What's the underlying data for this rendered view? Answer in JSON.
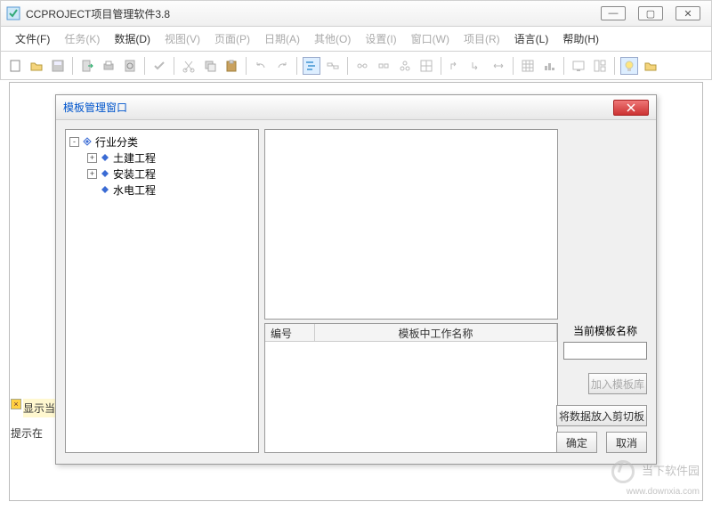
{
  "window": {
    "title": "CCPROJECT项目管理软件3.8"
  },
  "menu": {
    "file": "文件(F)",
    "task": "任务(K)",
    "data": "数据(D)",
    "view": "视图(V)",
    "page": "页面(P)",
    "date": "日期(A)",
    "other": "其他(O)",
    "settings": "设置(I)",
    "window": "窗口(W)",
    "project": "项目(R)",
    "language": "语言(L)",
    "help": "帮助(H)"
  },
  "dialog": {
    "title": "模板管理窗口",
    "tree": {
      "root": "行业分类",
      "items": [
        "土建工程",
        "安装工程",
        "水电工程"
      ]
    },
    "list": {
      "col1": "编号",
      "col2": "模板中工作名称"
    },
    "right": {
      "label": "当前模板名称",
      "btn_add": "加入模板库",
      "btn_clipboard": "将数据放入剪切板",
      "btn_ok": "确定",
      "btn_cancel": "取消"
    }
  },
  "hints": {
    "h1": "显示当",
    "h2": "提示在"
  },
  "watermark": {
    "name": "当下软件园",
    "url": "www.downxia.com"
  }
}
